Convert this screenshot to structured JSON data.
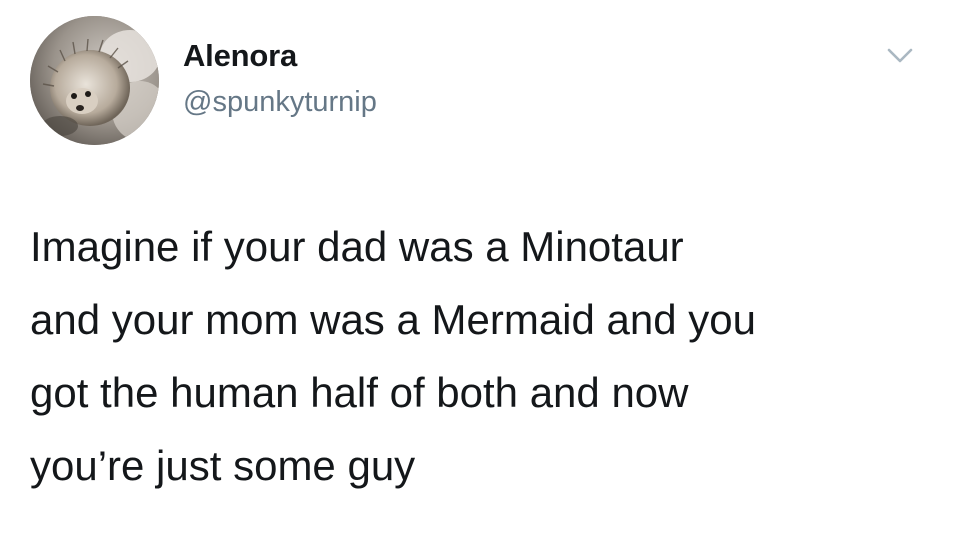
{
  "tweet": {
    "author": {
      "display_name": "Alenora",
      "handle": "@spunkyturnip",
      "avatar_icon": "hedgehog-avatar"
    },
    "menu_icon": "chevron-down-icon",
    "text_lines": [
      "Imagine if your dad was a Minotaur",
      "and your mom was a Mermaid and you",
      "got the human half of both and now",
      "you’re just some guy"
    ]
  },
  "colors": {
    "background": "#ffffff",
    "text": "#14171a",
    "secondary_text": "#657786",
    "caret": "#aab8c2"
  }
}
